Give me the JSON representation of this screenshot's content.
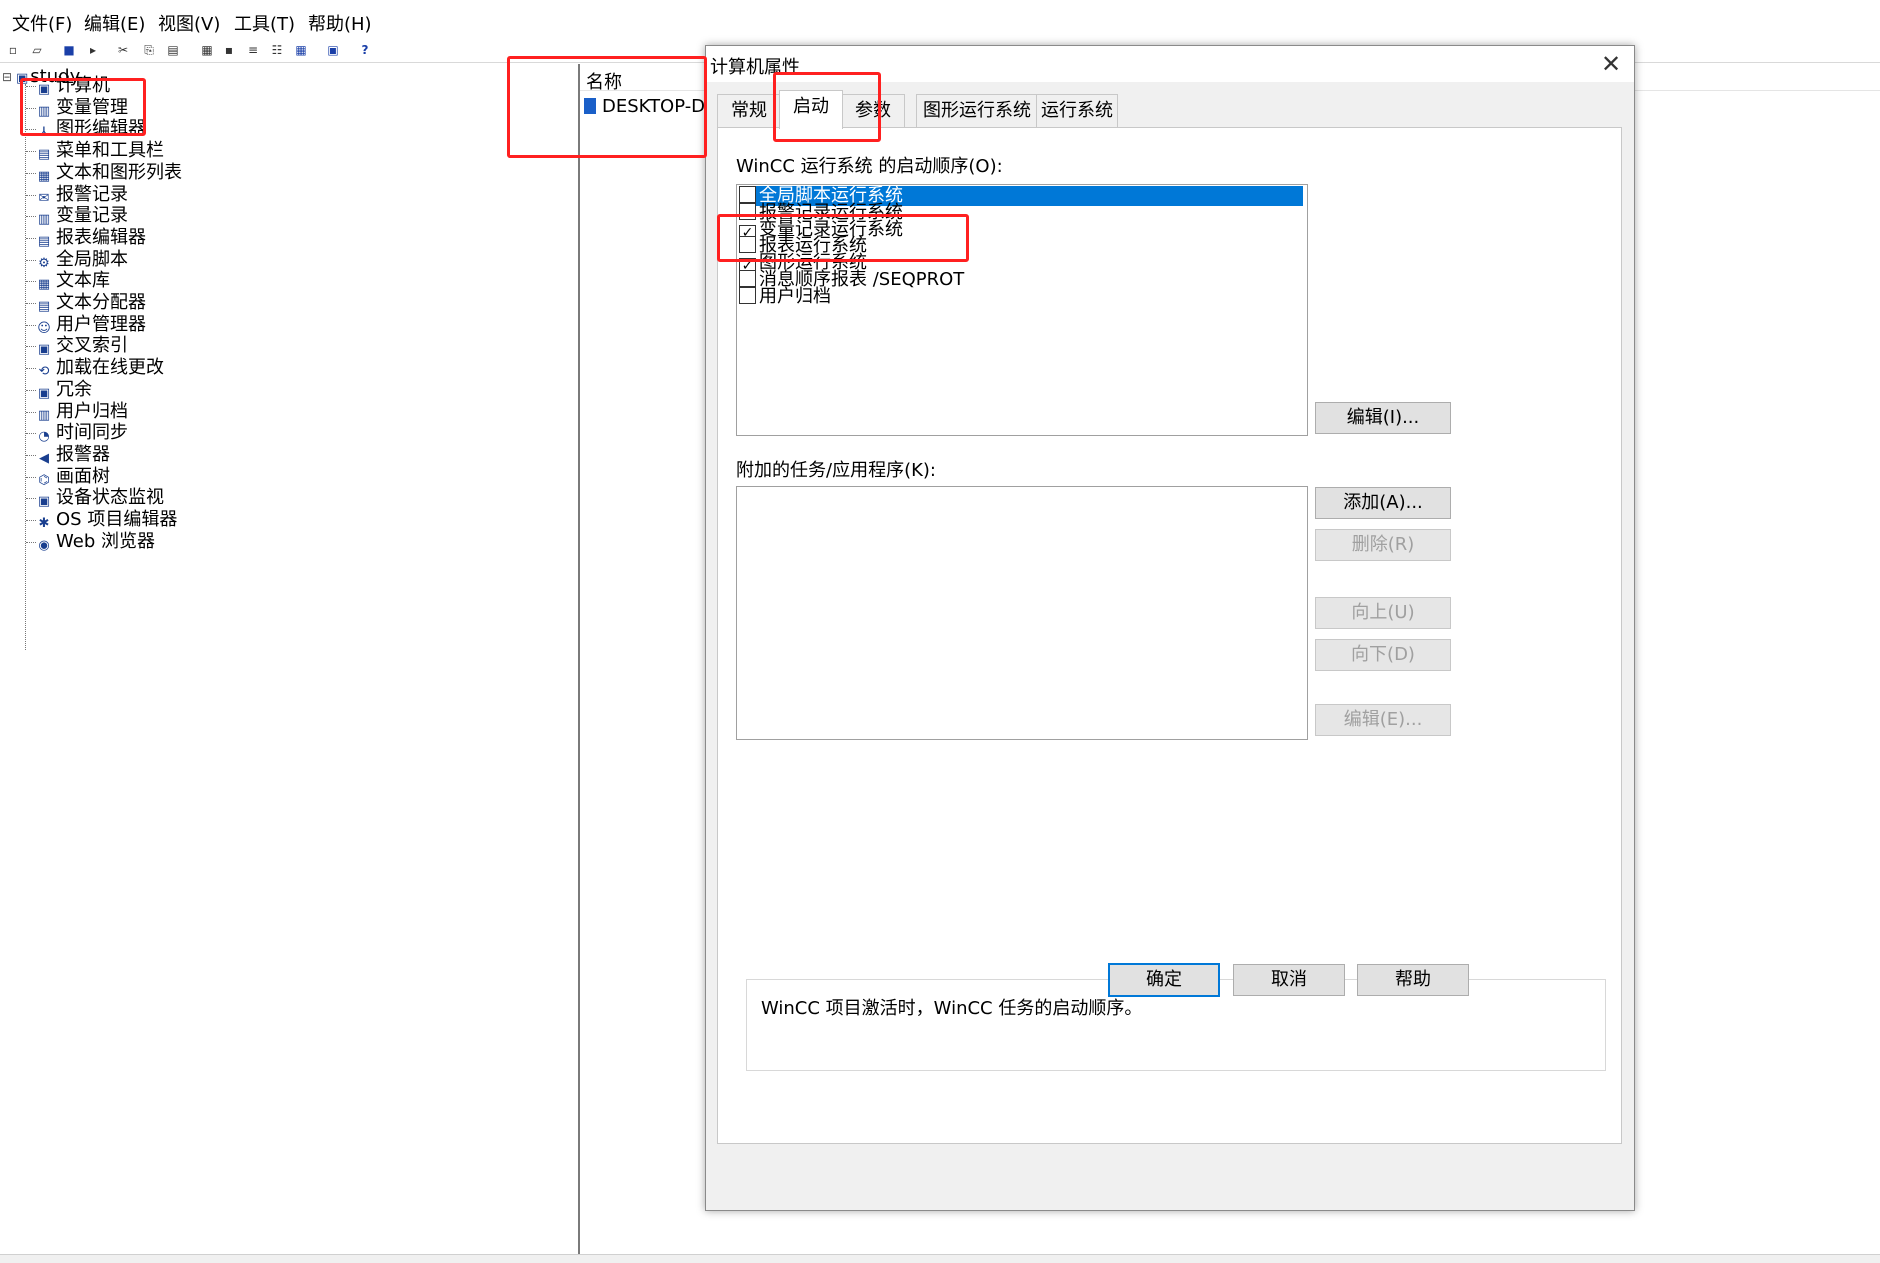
{
  "menu": [
    "文件(F)",
    "编辑(E)",
    "视图(V)",
    "工具(T)",
    "帮助(H)"
  ],
  "toolbar_icons": [
    "new-icon",
    "open-icon",
    "stop-icon",
    "run-icon",
    "cut-icon",
    "copy-icon",
    "paste-icon",
    "large-icons-icon",
    "small-icons-icon",
    "list-icon",
    "details-icon",
    "tile-icon",
    "properties-icon",
    "help-icon"
  ],
  "tree": {
    "root": "study",
    "items": [
      "计算机",
      "变量管理",
      "图形编辑器",
      "菜单和工具栏",
      "文本和图形列表",
      "报警记录",
      "变量记录",
      "报表编辑器",
      "全局脚本",
      "文本库",
      "文本分配器",
      "用户管理器",
      "交叉索引",
      "加载在线更改",
      "冗余",
      "用户归档",
      "时间同步",
      "报警器",
      "画面树",
      "设备状态监视",
      "OS 项目编辑器",
      "Web 浏览器"
    ]
  },
  "list": {
    "header": "名称",
    "rows": [
      "DESKTOP-D"
    ]
  },
  "dialog": {
    "title": "计算机属性",
    "tabs": [
      "常规",
      "启动",
      "参数",
      "图形运行系统",
      "运行系统"
    ],
    "active_tab": "启动",
    "startup_label": "WinCC 运行系统 的启动顺序(O):",
    "startup_items": [
      {
        "label": "全局脚本运行系统",
        "checked": false,
        "selected": true
      },
      {
        "label": "报警记录运行系统",
        "checked": false,
        "selected": false
      },
      {
        "label": "变量记录运行系统",
        "checked": true,
        "selected": false
      },
      {
        "label": "报表运行系统",
        "checked": false,
        "selected": false
      },
      {
        "label": "图形运行系统",
        "checked": true,
        "selected": false
      },
      {
        "label": "消息顺序报表 /SEQPROT",
        "checked": false,
        "selected": false
      },
      {
        "label": "用户归档",
        "checked": false,
        "selected": false
      }
    ],
    "edit_button_1": "编辑(I)...",
    "tasks_label": "附加的任务/应用程序(K):",
    "add_button": "添加(A)...",
    "delete_button": "删除(R)",
    "up_button": "向上(U)",
    "down_button": "向下(D)",
    "edit_button_2": "编辑(E)...",
    "description": "WinCC 项目激活时，WinCC 任务的启动顺序。",
    "ok_button": "确定",
    "cancel_button": "取消",
    "help_button": "帮助",
    "close_glyph": "✕"
  },
  "colors": {
    "highlight": "#ff2020",
    "selection": "#0078d7"
  }
}
